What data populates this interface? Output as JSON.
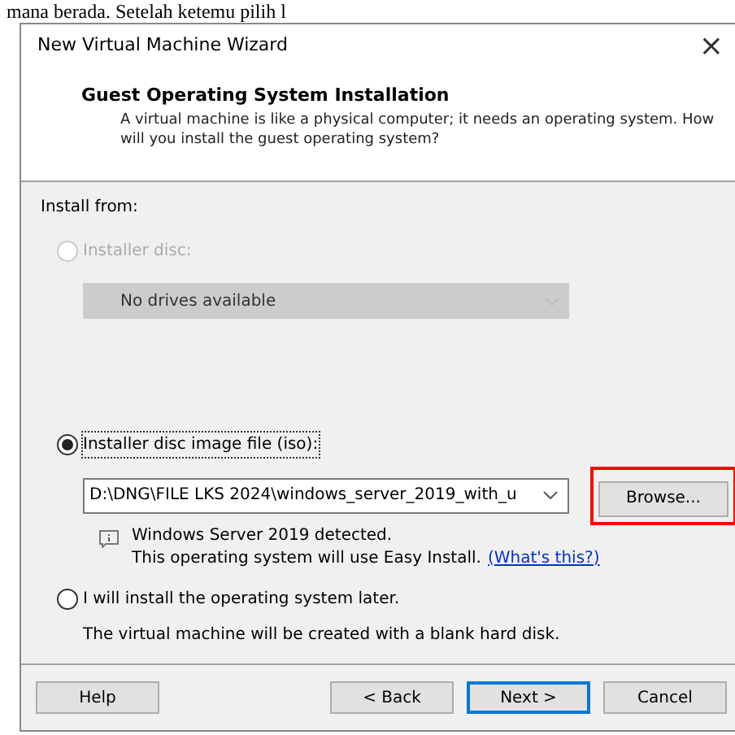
{
  "document_text": "mana berada. Setelah ketemu pilih l",
  "window": {
    "title": "New Virtual Machine Wizard",
    "close": "×"
  },
  "header": {
    "title": "Guest Operating System Installation",
    "description": "A virtual machine is like a physical computer; it needs an operating system. How will you install the guest operating system?"
  },
  "install_from": {
    "label": "Install from:",
    "options": [
      {
        "kind": "disc",
        "label": "Installer disc:",
        "selected": false,
        "disabled": true,
        "dropdown": {
          "value": "No drives available"
        }
      },
      {
        "kind": "iso",
        "label": "Installer disc image file (iso):",
        "selected": true,
        "disabled": false,
        "dropdown": {
          "value": "D:\\DNG\\FILE LKS 2024\\windows_server_2019_with_u"
        },
        "browse": {
          "label": "Browse...",
          "highlighted": true
        },
        "info": {
          "line1": "Windows Server 2019 detected.",
          "line2": "This operating system will use Easy Install.",
          "link": "(What's this?)"
        }
      },
      {
        "kind": "later",
        "label": "I will install the operating system later.",
        "selected": false,
        "disabled": false,
        "note": "The virtual machine will be created with a blank hard disk."
      }
    ]
  },
  "buttons": [
    {
      "label": "Help",
      "default": false
    },
    {
      "label": "< Back",
      "default": false
    },
    {
      "label": "Next >",
      "default": true
    },
    {
      "label": "Cancel",
      "default": false
    }
  ]
}
